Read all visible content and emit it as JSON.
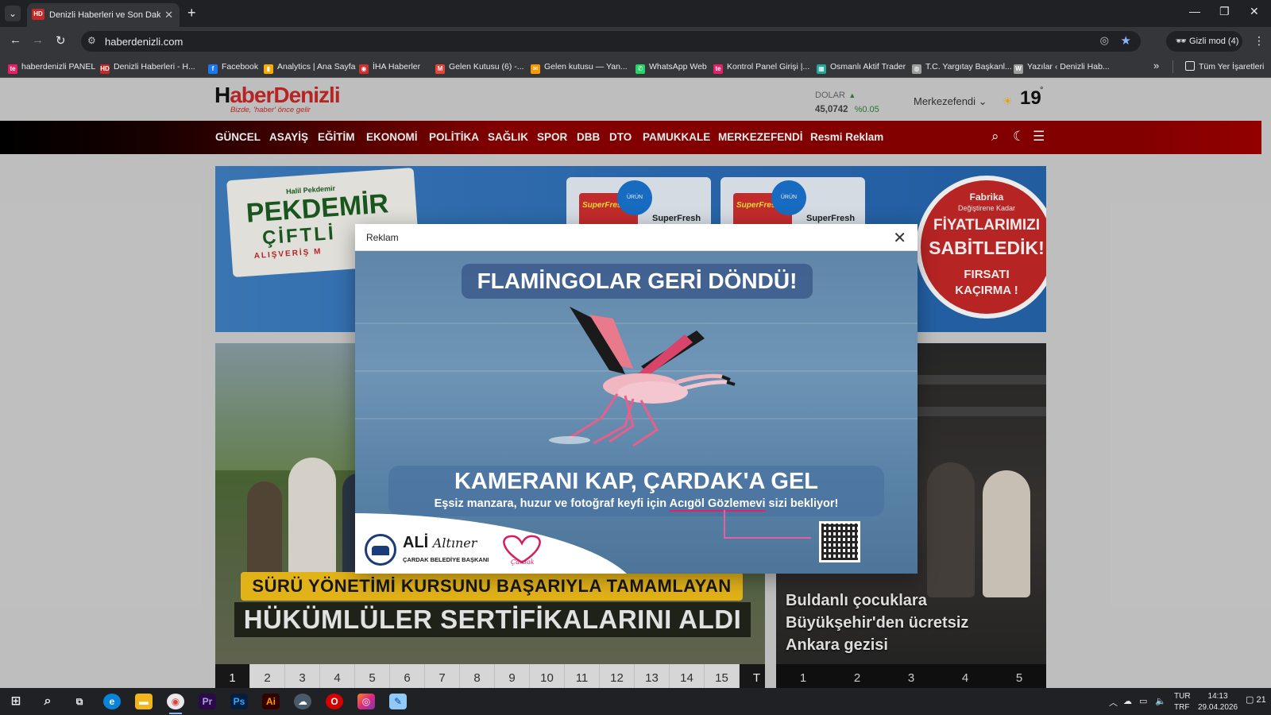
{
  "browser": {
    "tab_title": "Denizli Haberleri ve Son Dakika",
    "tab_favicon": "HD",
    "url": "haberdenizli.com",
    "incognito_label": "Gizli mod (4)",
    "bookmarks": [
      {
        "label": "haberdenizli PANEL",
        "icon": "te",
        "color": "#e91e63"
      },
      {
        "label": "Denizli Haberleri - H...",
        "icon": "HD",
        "color": "#c62828"
      },
      {
        "label": "Facebook",
        "icon": "f",
        "color": "#1877f2"
      },
      {
        "label": "Analytics | Ana Sayfa",
        "icon": "▮",
        "color": "#f9ab00"
      },
      {
        "label": "İHA Haberler",
        "icon": "◉",
        "color": "#d32f2f"
      },
      {
        "label": "Gelen Kutusu (6) -...",
        "icon": "M",
        "color": "#ea4335"
      },
      {
        "label": "Gelen kutusu — Yan...",
        "icon": "✉",
        "color": "#ff9800"
      },
      {
        "label": "WhatsApp Web",
        "icon": "✆",
        "color": "#25d366"
      },
      {
        "label": "Kontrol Panel Girişi |...",
        "icon": "te",
        "color": "#e91e63"
      },
      {
        "label": "Osmanlı Aktif Trader",
        "icon": "▦",
        "color": "#26a69a"
      },
      {
        "label": "T.C. Yargıtay Başkanl...",
        "icon": "◍",
        "color": "#9e9e9e"
      },
      {
        "label": "Yazılar ‹ Denizli Hab...",
        "icon": "W",
        "color": "#9e9e9e"
      }
    ],
    "all_bookmarks_label": "Tüm Yer İşaretleri"
  },
  "site": {
    "logo_h": "H",
    "logo_rest": "aberDenizli",
    "logo_slogan": "Bizde, 'haber' önce gelir",
    "currency_label": "DOLAR",
    "currency_value": "45,0742",
    "currency_change": "%0.05",
    "city": "Merkezefendi",
    "temperature": "19",
    "temperature_unit": "°",
    "nav": [
      "GÜNCEL",
      "ASAYİŞ",
      "EĞİTİM",
      "EKONOMİ",
      "POLİTİKA",
      "SAĞLIK",
      "SPOR",
      "DBB",
      "DTO",
      "PAMUKKALE",
      "MERKEZEFENDİ",
      "Resmi Reklam"
    ],
    "banner": {
      "small": "Halil Pekdemir",
      "name": "PEKDEMİR",
      "sub": "ÇİFTLİ",
      "tag": "ALIŞVERİŞ M",
      "product": "SuperFresh",
      "product_pack": "SuperFresh",
      "seal": "ÜRÜN",
      "promo_1": "Fabrika",
      "promo_2": "Değiştirene Kadar",
      "promo_3": "FİYATLARIMIZI",
      "promo_4": "SABİTLEDİK!",
      "promo_5": "FIRSATI",
      "promo_6": "KAÇIRMA !"
    },
    "headline_1": "SÜRÜ YÖNETİMİ KURSUNU BAŞARIYLA TAMAMLAYAN",
    "headline_2": "HÜKÜMLÜLER SERTİFİKALARINI ALDI",
    "pager_left": [
      "1",
      "2",
      "3",
      "4",
      "5",
      "6",
      "7",
      "8",
      "9",
      "10",
      "11",
      "12",
      "13",
      "14",
      "15",
      "T"
    ],
    "right_title": "Buldanlı çocuklara Büyükşehir'den ücretsiz Ankara gezisi",
    "pager_right": [
      "1",
      "2",
      "3",
      "4",
      "5"
    ]
  },
  "modal": {
    "title": "Reklam",
    "ad_title": "FLAMİNGOLAR GERİ DÖNDÜ!",
    "ad_cta": "KAMERANI KAP, ÇARDAK'A GEL",
    "ad_sub_1": "Eşsiz manzara, huzur ve fotoğraf keyfi için ",
    "ad_sub_hl": "Acıgöl Gözlemevi",
    "ad_sub_2": " sizi bekliyor!",
    "ali_name": "ALİ",
    "ali_surname": "Altıner",
    "ali_role": "ÇARDAK BELEDİYE BAŞKANI",
    "cardak": "Çardak"
  },
  "taskbar": {
    "lang_1": "TUR",
    "lang_2": "TRF",
    "time": "14:13",
    "date": "29.04.2026",
    "notifications": "21"
  }
}
